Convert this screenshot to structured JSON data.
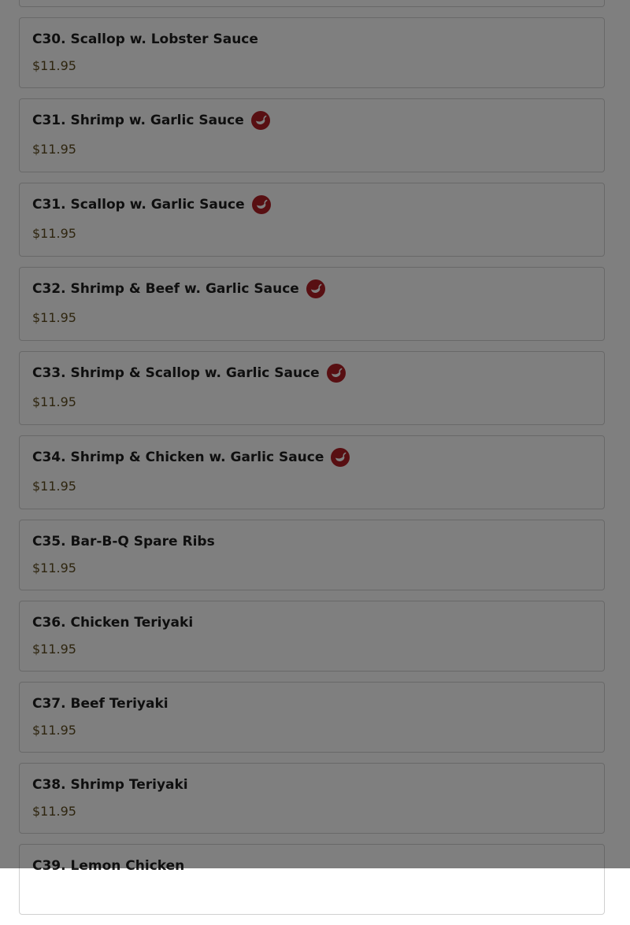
{
  "menu": {
    "items": [
      {
        "name": "C30. Scallop w. Lobster Sauce",
        "price": "$11.95",
        "spicy": false
      },
      {
        "name": "C31. Shrimp w. Garlic Sauce",
        "price": "$11.95",
        "spicy": true
      },
      {
        "name": "C31. Scallop w. Garlic Sauce",
        "price": "$11.95",
        "spicy": true
      },
      {
        "name": "C32. Shrimp & Beef w. Garlic Sauce",
        "price": "$11.95",
        "spicy": true
      },
      {
        "name": "C33. Shrimp & Scallop w. Garlic Sauce",
        "price": "$11.95",
        "spicy": true
      },
      {
        "name": "C34. Shrimp & Chicken w. Garlic Sauce",
        "price": "$11.95",
        "spicy": true
      },
      {
        "name": "C35. Bar-B-Q Spare Ribs",
        "price": "$11.95",
        "spicy": false
      },
      {
        "name": "C36. Chicken Teriyaki",
        "price": "$11.95",
        "spicy": false
      },
      {
        "name": "C37. Beef Teriyaki",
        "price": "$11.95",
        "spicy": false
      },
      {
        "name": "C38. Shrimp Teriyaki",
        "price": "$11.95",
        "spicy": false
      },
      {
        "name": "C39. Lemon Chicken",
        "price": "",
        "spicy": false
      }
    ]
  },
  "colors": {
    "spicy_icon": "#b01e24",
    "price_text": "#5c4a1e",
    "overlay": "rgba(0,0,0,0.5)"
  },
  "icons": {
    "spicy": "chili-pepper-icon"
  }
}
